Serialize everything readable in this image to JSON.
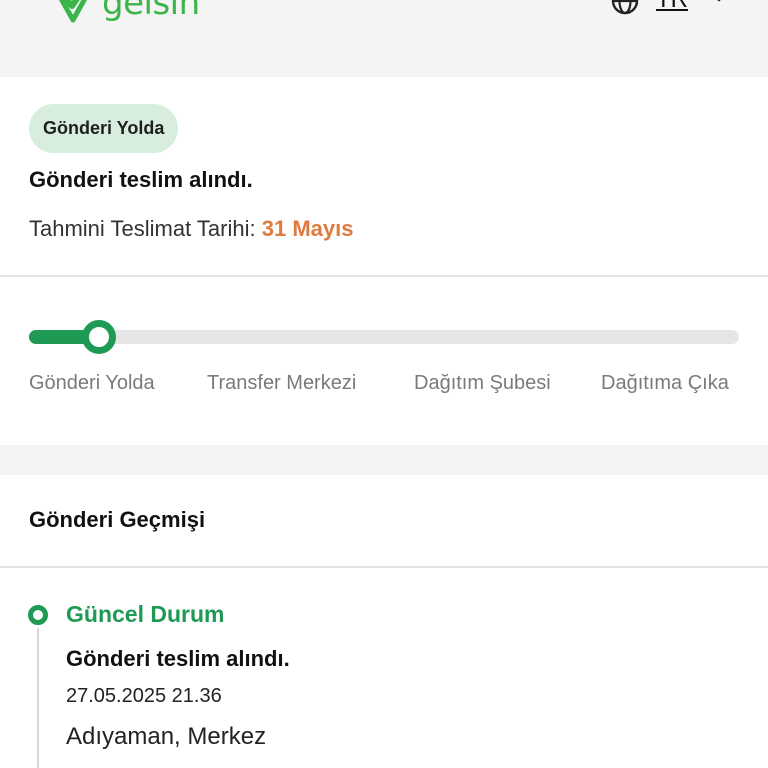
{
  "header": {
    "brand": "gelsin",
    "language": "TR",
    "icons": [
      "gelsin-logo-icon",
      "globe-icon",
      "chevron-down-icon"
    ],
    "brand_color": "#3bb54a"
  },
  "status": {
    "badge": "Gönderi Yolda",
    "title": "Gönderi teslim alındı.",
    "eta_label": "Tahmini Teslimat Tarihi:",
    "eta_date": "31 Mayıs",
    "eta_color": "#e07a3e",
    "badge_color": "#d7eedf"
  },
  "progress": {
    "accent": "#1e9a55",
    "current_step": 1,
    "fill_fraction": 0.1,
    "steps": [
      "Gönderi Yolda",
      "Transfer Merkezi",
      "Dağıtım Şubesi",
      "Dağıtıma Çıka"
    ]
  },
  "history": {
    "title": "Gönderi Geçmişi",
    "events": [
      {
        "status": "Güncel Durum",
        "title": "Gönderi teslim alındı.",
        "time": "27.05.2025 21.36",
        "location": "Adıyaman, Merkez"
      }
    ]
  }
}
